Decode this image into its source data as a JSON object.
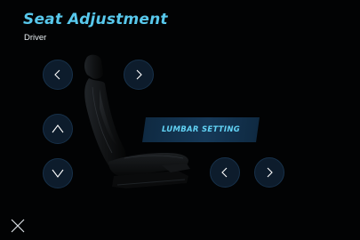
{
  "header": {
    "title": "Seat Adjustment",
    "subtitle": "Driver"
  },
  "lumbar": {
    "label": "LUMBAR SETTING"
  },
  "icons": {
    "seat_back": "chevron-left-icon",
    "seat_forward": "chevron-right-icon",
    "seat_up": "chevron-up-icon",
    "seat_down": "chevron-down-icon",
    "lumbar_left": "chevron-left-icon",
    "lumbar_right": "chevron-right-icon",
    "close": "close-icon",
    "seat": "car-seat-icon"
  },
  "colors": {
    "accent": "#58c8ec",
    "button_fill": "#0d1c2c",
    "background": "#020304"
  }
}
